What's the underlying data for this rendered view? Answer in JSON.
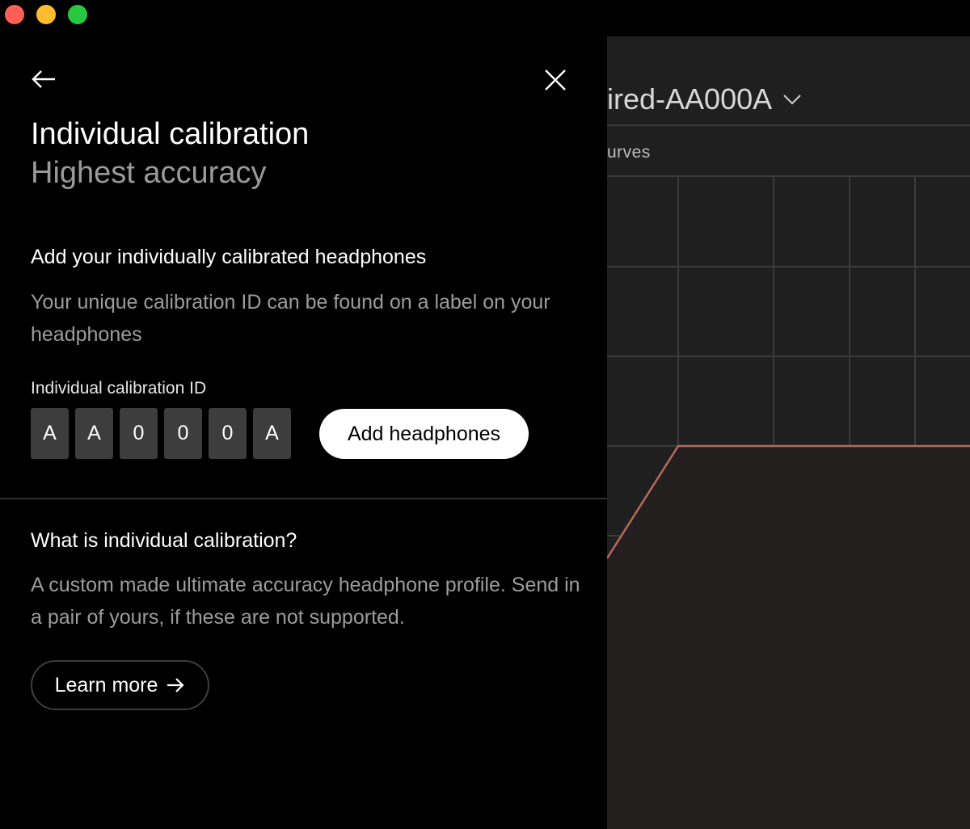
{
  "window": {
    "controls": [
      "close",
      "minimize",
      "zoom"
    ]
  },
  "background_app": {
    "device_title": "ired-AA000A",
    "tab_label": "urves",
    "icons": {
      "dropdown": "chevron-down-icon"
    },
    "curve_color": "#b56a5c"
  },
  "panel": {
    "icons": {
      "back": "arrow-left-icon",
      "close": "close-icon"
    },
    "title": "Individual calibration",
    "subtitle": "Highest accuracy",
    "add_section": {
      "heading": "Add your individually calibrated headphones",
      "description": "Your unique calibration ID can be found on a label on your headphones",
      "field_label": "Individual calibration ID",
      "id_chars": [
        "A",
        "A",
        "0",
        "0",
        "0",
        "A"
      ],
      "add_button": "Add headphones"
    },
    "info_section": {
      "heading": "What is individual calibration?",
      "description": "A custom made ultimate accuracy headphone profile. Send in a pair of yours, if these are not supported.",
      "learn_more_button": "Learn more",
      "learn_more_icon": "arrow-right-icon"
    }
  }
}
